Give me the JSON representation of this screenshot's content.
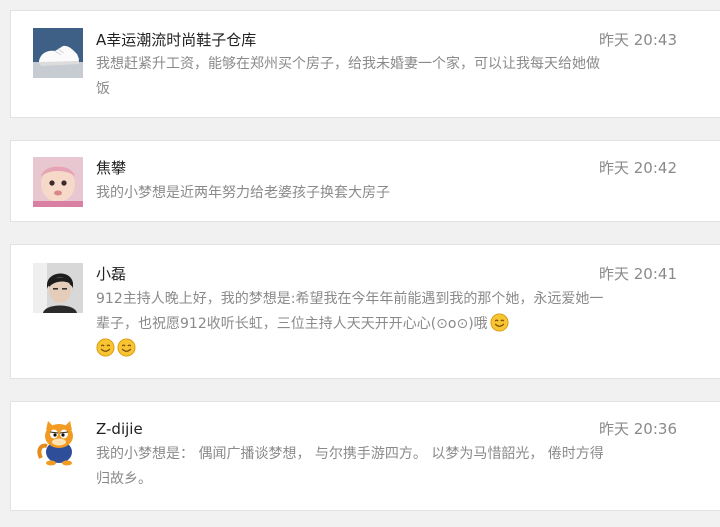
{
  "comments": [
    {
      "name": "A幸运潮流时尚鞋子仓库",
      "time": "昨天 20:43",
      "text": "我想赶紧升工资，能够在郑州买个房子，给我未婚妻一个家，可以让我每天给她做饭",
      "avatar_icon": "white-sneaker-avatar"
    },
    {
      "name": "焦攀",
      "time": "昨天 20:42",
      "text": "我的小梦想是近两年努力给老婆孩子换套大房子",
      "avatar_icon": "baby-photo-avatar"
    },
    {
      "name": "小磊",
      "time": "昨天 20:41",
      "text": "912主持人晚上好，我的梦想是:希望我在今年年前能遇到我的那个她，永远爱她一辈子，也祝愿912收听长虹，三位主持人天天开开心心(⊙o⊙)哦",
      "avatar_icon": "man-portrait-avatar",
      "emoji_icon": "smile-emoji-icon"
    },
    {
      "name": "Z-dijie",
      "time": "昨天 20:36",
      "text": "我的小梦想是： 偶闻广播谈梦想， 与尔携手游四方。 以梦为马惜韶光， 倦时方得归故乡。",
      "avatar_icon": "cartoon-cat-avatar"
    }
  ],
  "colors": {
    "page_background": "#f1f1f1",
    "card_background": "#ffffff",
    "card_border": "#e2e2e2",
    "name_text": "#222222",
    "secondary_text": "#8a8a8a"
  }
}
